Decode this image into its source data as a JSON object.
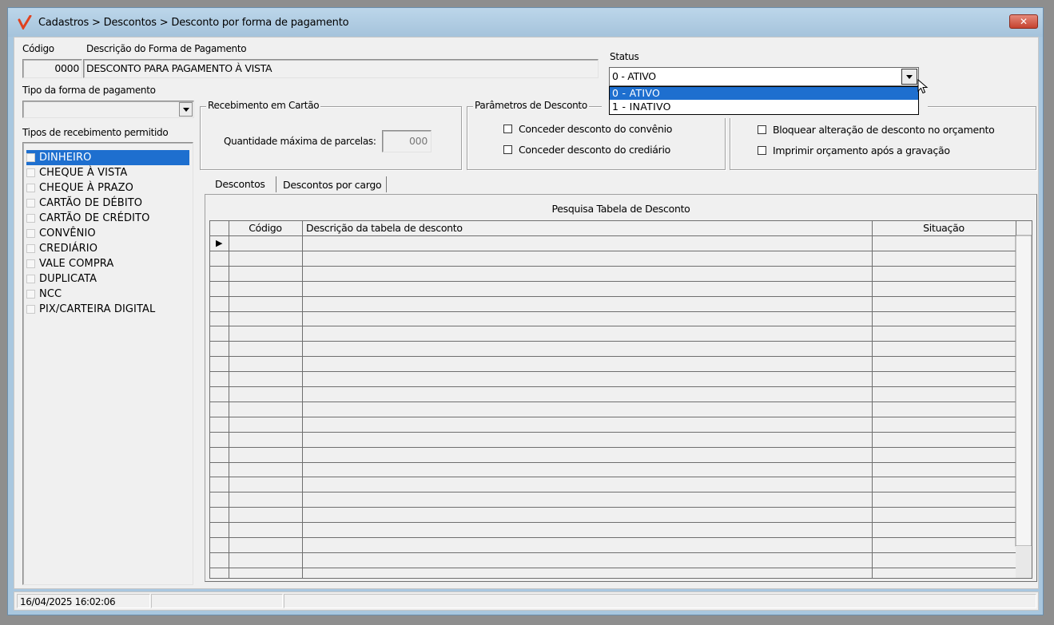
{
  "window": {
    "title": "Cadastros > Descontos > Desconto por forma de pagamento",
    "close_label": "✕"
  },
  "form": {
    "codigo_label": "Código",
    "codigo_value": "0000",
    "descricao_label": "Descrição do Forma de Pagamento",
    "descricao_value": "DESCONTO PARA PAGAMENTO À VISTA",
    "status_label": "Status",
    "status_value": "0 - ATIVO",
    "status_options": [
      "0 - ATIVO",
      "1 - INATIVO"
    ],
    "tipo_forma_label": "Tipo da forma de pagamento",
    "tipo_forma_value": "",
    "tipos_recebimento_label": "Tipos de recebimento permitido",
    "tipos_recebimento": [
      "DINHEIRO",
      "CHEQUE À VISTA",
      "CHEQUE À PRAZO",
      "CARTÃO DE DÉBITO",
      "CARTÃO DE CRÉDITO",
      "CONVÊNIO",
      "CREDIÁRIO",
      "VALE COMPRA",
      "DUPLICATA",
      "NCC",
      "PIX/CARTEIRA DIGITAL"
    ]
  },
  "cartao": {
    "group_title": "Recebimento em Cartão",
    "parcelas_label": "Quantidade máxima de parcelas:",
    "parcelas_value": "000"
  },
  "parametros": {
    "group_title": "Parâmetros de Desconto",
    "convenio_label": "Conceder desconto do convênio",
    "crediario_label": "Conceder desconto do crediário"
  },
  "opcoes": {
    "bloquear_label": "Bloquear alteração de desconto no orçamento",
    "imprimir_label": "Imprimir orçamento após a gravação"
  },
  "tabs": {
    "descontos": "Descontos",
    "descontos_cargo": "Descontos por cargo"
  },
  "grid": {
    "title": "Pesquisa Tabela de Desconto",
    "col_codigo": "Código",
    "col_descricao": "Descrição da tabela de desconto",
    "col_situacao": "Situação",
    "row_indicator": "▶"
  },
  "statusbar": {
    "datetime": "16/04/2025 16:02:06",
    "panel2": "",
    "panel3": ""
  },
  "colors": {
    "selection": "#1e6fcf",
    "title_bar": "#a9c7df",
    "face": "#f0f0f0"
  }
}
